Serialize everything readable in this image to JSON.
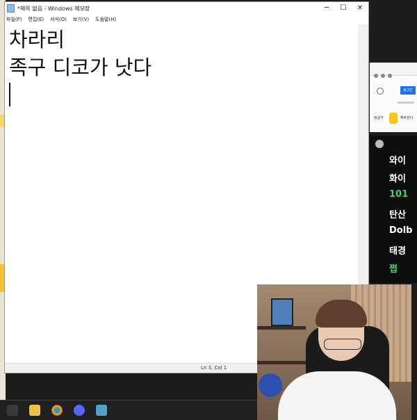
{
  "window": {
    "title": "*제목 없음 - Windows 메모장",
    "minimize": "─",
    "maximize": "☐",
    "close": "✕"
  },
  "menu": [
    "파일(F)",
    "편집(E)",
    "서식(O)",
    "보기(V)",
    "도움말(H)"
  ],
  "editor": {
    "lines": [
      "차라리",
      "족구 디코가 낫다"
    ]
  },
  "status": {
    "position": "Ln 3, Col 1"
  },
  "browser": {
    "login_label": "로그인",
    "chip1": "정글가",
    "chip2": "해주한다"
  },
  "chat": {
    "messages": [
      "와이",
      "화이",
      "101",
      "탄산",
      "Dolb",
      "태경",
      "쩝"
    ]
  },
  "taskbar": {
    "icons": [
      "folder-icon",
      "chrome-icon",
      "discord-icon",
      "app-icon"
    ]
  }
}
